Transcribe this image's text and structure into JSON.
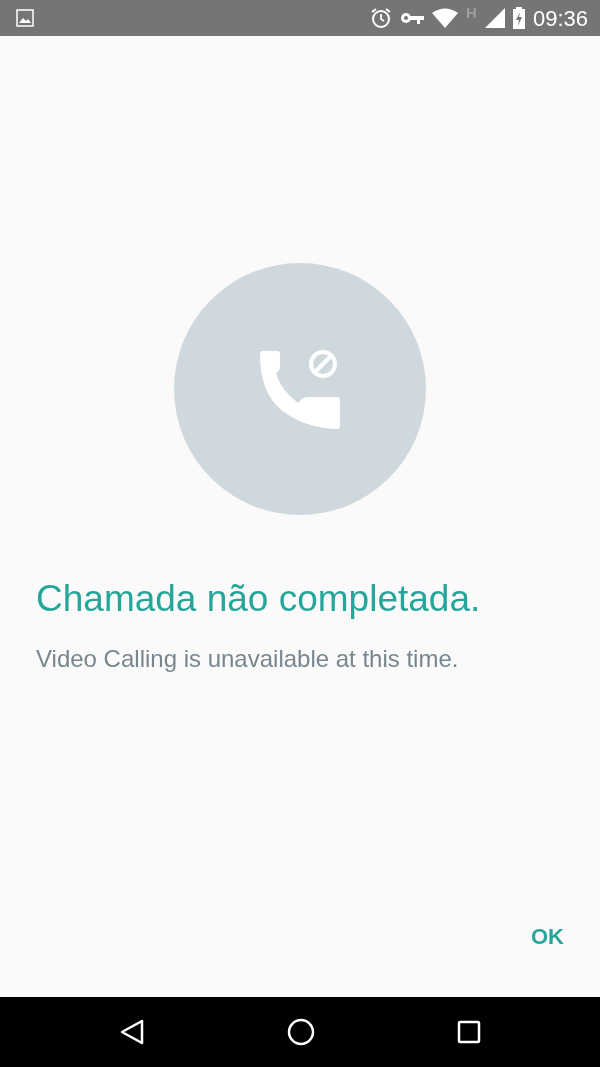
{
  "status_bar": {
    "network_type": "H",
    "time": "09:36"
  },
  "dialog": {
    "title": "Chamada não completada.",
    "message": "Video Calling is unavailable at this time.",
    "buttons": [
      {
        "label": "OK"
      }
    ]
  }
}
